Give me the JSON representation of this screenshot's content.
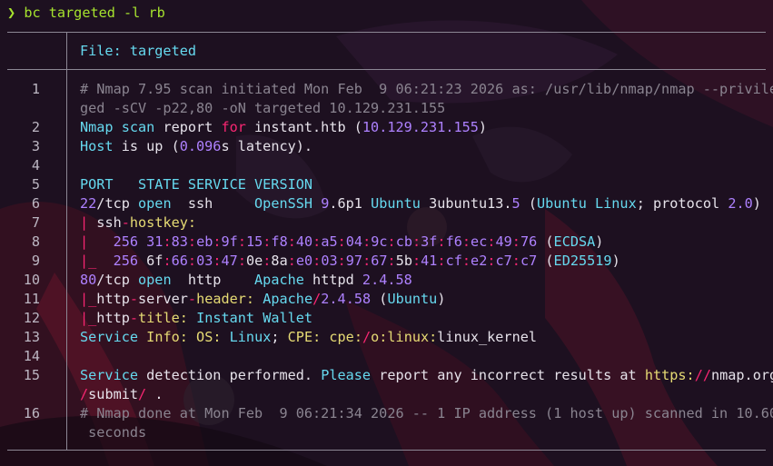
{
  "colors": {
    "background": "#1a0f1c",
    "text": "#e6e2ea",
    "comment": "#8a8490",
    "cyan": "#66d9ef",
    "pink": "#f92672",
    "purple": "#ae81ff",
    "yellow": "#e6db74",
    "green": "#a6e22e",
    "rule": "#8c8794"
  },
  "prompt": {
    "symbol": "❯",
    "command": "bc targeted -l rb"
  },
  "file": {
    "label": "File: targeted"
  },
  "lines": [
    {
      "no": "1",
      "rows": [
        [
          [
            "c-comment",
            "# Nmap 7.95 scan initiated Mon Feb  9 06:21:23 2026 as: /usr/lib/nmap/nmap --privile"
          ]
        ],
        [
          [
            "c-comment",
            "ged -sCV -p22,80 -oN targeted 10.129.231.155"
          ]
        ]
      ]
    },
    {
      "no": "2",
      "rows": [
        [
          [
            "c-cyan",
            "Nmap scan"
          ],
          [
            "c-text",
            " report "
          ],
          [
            "c-pink",
            "for"
          ],
          [
            "c-text",
            " instant.htb ("
          ],
          [
            "c-purple",
            "10.129.231.155"
          ],
          [
            "c-text",
            ")"
          ]
        ]
      ]
    },
    {
      "no": "3",
      "rows": [
        [
          [
            "c-cyan",
            "Host"
          ],
          [
            "c-text",
            " is up ("
          ],
          [
            "c-purple",
            "0.096"
          ],
          [
            "c-text",
            "s latency)."
          ]
        ]
      ]
    },
    {
      "no": "4",
      "rows": [
        [
          [
            "c-text",
            ""
          ]
        ]
      ]
    },
    {
      "no": "5",
      "rows": [
        [
          [
            "c-cyan",
            "PORT   STATE SERVICE VERSION"
          ]
        ]
      ]
    },
    {
      "no": "6",
      "rows": [
        [
          [
            "c-purple",
            "22"
          ],
          [
            "c-text",
            "/tcp "
          ],
          [
            "c-cyan",
            "open"
          ],
          [
            "c-text",
            "  ssh     "
          ],
          [
            "c-cyan",
            "OpenSSH"
          ],
          [
            "c-text",
            " "
          ],
          [
            "c-purple",
            "9"
          ],
          [
            "c-text",
            ".6p1 "
          ],
          [
            "c-cyan",
            "Ubuntu"
          ],
          [
            "c-text",
            " 3ubuntu13."
          ],
          [
            "c-purple",
            "5"
          ],
          [
            "c-text",
            " ("
          ],
          [
            "c-cyan",
            "Ubuntu Linux"
          ],
          [
            "c-text",
            "; protocol "
          ],
          [
            "c-purple",
            "2.0"
          ],
          [
            "c-text",
            ")"
          ]
        ]
      ]
    },
    {
      "no": "7",
      "rows": [
        [
          [
            "c-pink",
            "| "
          ],
          [
            "c-text",
            "ssh"
          ],
          [
            "c-pink",
            "-"
          ],
          [
            "c-yellow",
            "hostkey:"
          ]
        ]
      ]
    },
    {
      "no": "8",
      "rows": [
        [
          [
            "c-pink",
            "|   "
          ],
          [
            "c-purple",
            "256 31"
          ],
          [
            "c-pink",
            ":"
          ],
          [
            "c-purple",
            "83"
          ],
          [
            "c-pink",
            ":"
          ],
          [
            "c-purple",
            "eb"
          ],
          [
            "c-pink",
            ":"
          ],
          [
            "c-purple",
            "9f"
          ],
          [
            "c-pink",
            ":"
          ],
          [
            "c-purple",
            "15"
          ],
          [
            "c-pink",
            ":"
          ],
          [
            "c-purple",
            "f8"
          ],
          [
            "c-pink",
            ":"
          ],
          [
            "c-purple",
            "40"
          ],
          [
            "c-pink",
            ":"
          ],
          [
            "c-purple",
            "a5"
          ],
          [
            "c-pink",
            ":"
          ],
          [
            "c-purple",
            "04"
          ],
          [
            "c-pink",
            ":"
          ],
          [
            "c-purple",
            "9c"
          ],
          [
            "c-pink",
            ":"
          ],
          [
            "c-purple",
            "cb"
          ],
          [
            "c-pink",
            ":"
          ],
          [
            "c-purple",
            "3f"
          ],
          [
            "c-pink",
            ":"
          ],
          [
            "c-purple",
            "f6"
          ],
          [
            "c-pink",
            ":"
          ],
          [
            "c-purple",
            "ec"
          ],
          [
            "c-pink",
            ":"
          ],
          [
            "c-purple",
            "49"
          ],
          [
            "c-pink",
            ":"
          ],
          [
            "c-purple",
            "76"
          ],
          [
            "c-text",
            " ("
          ],
          [
            "c-cyan",
            "ECDSA"
          ],
          [
            "c-text",
            ")"
          ]
        ]
      ]
    },
    {
      "no": "9",
      "rows": [
        [
          [
            "c-pink",
            "|_  "
          ],
          [
            "c-purple",
            "256"
          ],
          [
            "c-text",
            " 6f"
          ],
          [
            "c-pink",
            ":"
          ],
          [
            "c-purple",
            "66"
          ],
          [
            "c-pink",
            ":"
          ],
          [
            "c-purple",
            "03"
          ],
          [
            "c-pink",
            ":"
          ],
          [
            "c-purple",
            "47"
          ],
          [
            "c-pink",
            ":"
          ],
          [
            "c-text",
            "0e"
          ],
          [
            "c-pink",
            ":"
          ],
          [
            "c-text",
            "8a"
          ],
          [
            "c-pink",
            ":"
          ],
          [
            "c-purple",
            "e0"
          ],
          [
            "c-pink",
            ":"
          ],
          [
            "c-purple",
            "03"
          ],
          [
            "c-pink",
            ":"
          ],
          [
            "c-purple",
            "97"
          ],
          [
            "c-pink",
            ":"
          ],
          [
            "c-purple",
            "67"
          ],
          [
            "c-pink",
            ":"
          ],
          [
            "c-text",
            "5b"
          ],
          [
            "c-pink",
            ":"
          ],
          [
            "c-purple",
            "41"
          ],
          [
            "c-pink",
            ":"
          ],
          [
            "c-purple",
            "cf"
          ],
          [
            "c-pink",
            ":"
          ],
          [
            "c-purple",
            "e2"
          ],
          [
            "c-pink",
            ":"
          ],
          [
            "c-purple",
            "c7"
          ],
          [
            "c-pink",
            ":"
          ],
          [
            "c-purple",
            "c7"
          ],
          [
            "c-text",
            " ("
          ],
          [
            "c-cyan",
            "ED25519"
          ],
          [
            "c-text",
            ")"
          ]
        ]
      ]
    },
    {
      "no": "10",
      "rows": [
        [
          [
            "c-purple",
            "80"
          ],
          [
            "c-text",
            "/tcp "
          ],
          [
            "c-cyan",
            "open"
          ],
          [
            "c-text",
            "  http    "
          ],
          [
            "c-cyan",
            "Apache"
          ],
          [
            "c-text",
            " httpd "
          ],
          [
            "c-purple",
            "2.4.58"
          ]
        ]
      ]
    },
    {
      "no": "11",
      "rows": [
        [
          [
            "c-pink",
            "|_"
          ],
          [
            "c-text",
            "http"
          ],
          [
            "c-pink",
            "-"
          ],
          [
            "c-text",
            "server"
          ],
          [
            "c-pink",
            "-"
          ],
          [
            "c-yellow",
            "header:"
          ],
          [
            "c-text",
            " "
          ],
          [
            "c-cyan",
            "Apache"
          ],
          [
            "c-pink",
            "/"
          ],
          [
            "c-purple",
            "2.4.58"
          ],
          [
            "c-text",
            " ("
          ],
          [
            "c-cyan",
            "Ubuntu"
          ],
          [
            "c-text",
            ")"
          ]
        ]
      ]
    },
    {
      "no": "12",
      "rows": [
        [
          [
            "c-pink",
            "|_"
          ],
          [
            "c-text",
            "http"
          ],
          [
            "c-pink",
            "-"
          ],
          [
            "c-yellow",
            "title:"
          ],
          [
            "c-text",
            " "
          ],
          [
            "c-cyan",
            "Instant Wallet"
          ]
        ]
      ]
    },
    {
      "no": "13",
      "rows": [
        [
          [
            "c-cyan",
            "Service"
          ],
          [
            "c-text",
            " "
          ],
          [
            "c-yellow",
            "Info:"
          ],
          [
            "c-text",
            " "
          ],
          [
            "c-yellow",
            "OS:"
          ],
          [
            "c-text",
            " "
          ],
          [
            "c-cyan",
            "Linux"
          ],
          [
            "c-text",
            "; "
          ],
          [
            "c-yellow",
            "CPE:"
          ],
          [
            "c-text",
            " "
          ],
          [
            "c-yellow",
            "cpe:"
          ],
          [
            "c-pink",
            "/"
          ],
          [
            "c-yellow",
            "o:linux:"
          ],
          [
            "c-text",
            "linux_kernel"
          ]
        ]
      ]
    },
    {
      "no": "14",
      "rows": [
        [
          [
            "c-text",
            ""
          ]
        ]
      ]
    },
    {
      "no": "15",
      "rows": [
        [
          [
            "c-cyan",
            "Service"
          ],
          [
            "c-text",
            " detection performed. "
          ],
          [
            "c-cyan",
            "Please"
          ],
          [
            "c-text",
            " report any incorrect results at "
          ],
          [
            "c-yellow",
            "https:"
          ],
          [
            "c-pink",
            "//"
          ],
          [
            "c-text",
            "nmap.org"
          ]
        ],
        [
          [
            "c-pink",
            "/"
          ],
          [
            "c-text",
            "submit"
          ],
          [
            "c-pink",
            "/"
          ],
          [
            "c-text",
            " ."
          ]
        ]
      ]
    },
    {
      "no": "16",
      "rows": [
        [
          [
            "c-comment",
            "# Nmap done at Mon Feb  9 06:21:34 2026 -- 1 IP address (1 host up) scanned in 10.60"
          ]
        ],
        [
          [
            "c-comment",
            " seconds"
          ]
        ]
      ]
    }
  ]
}
